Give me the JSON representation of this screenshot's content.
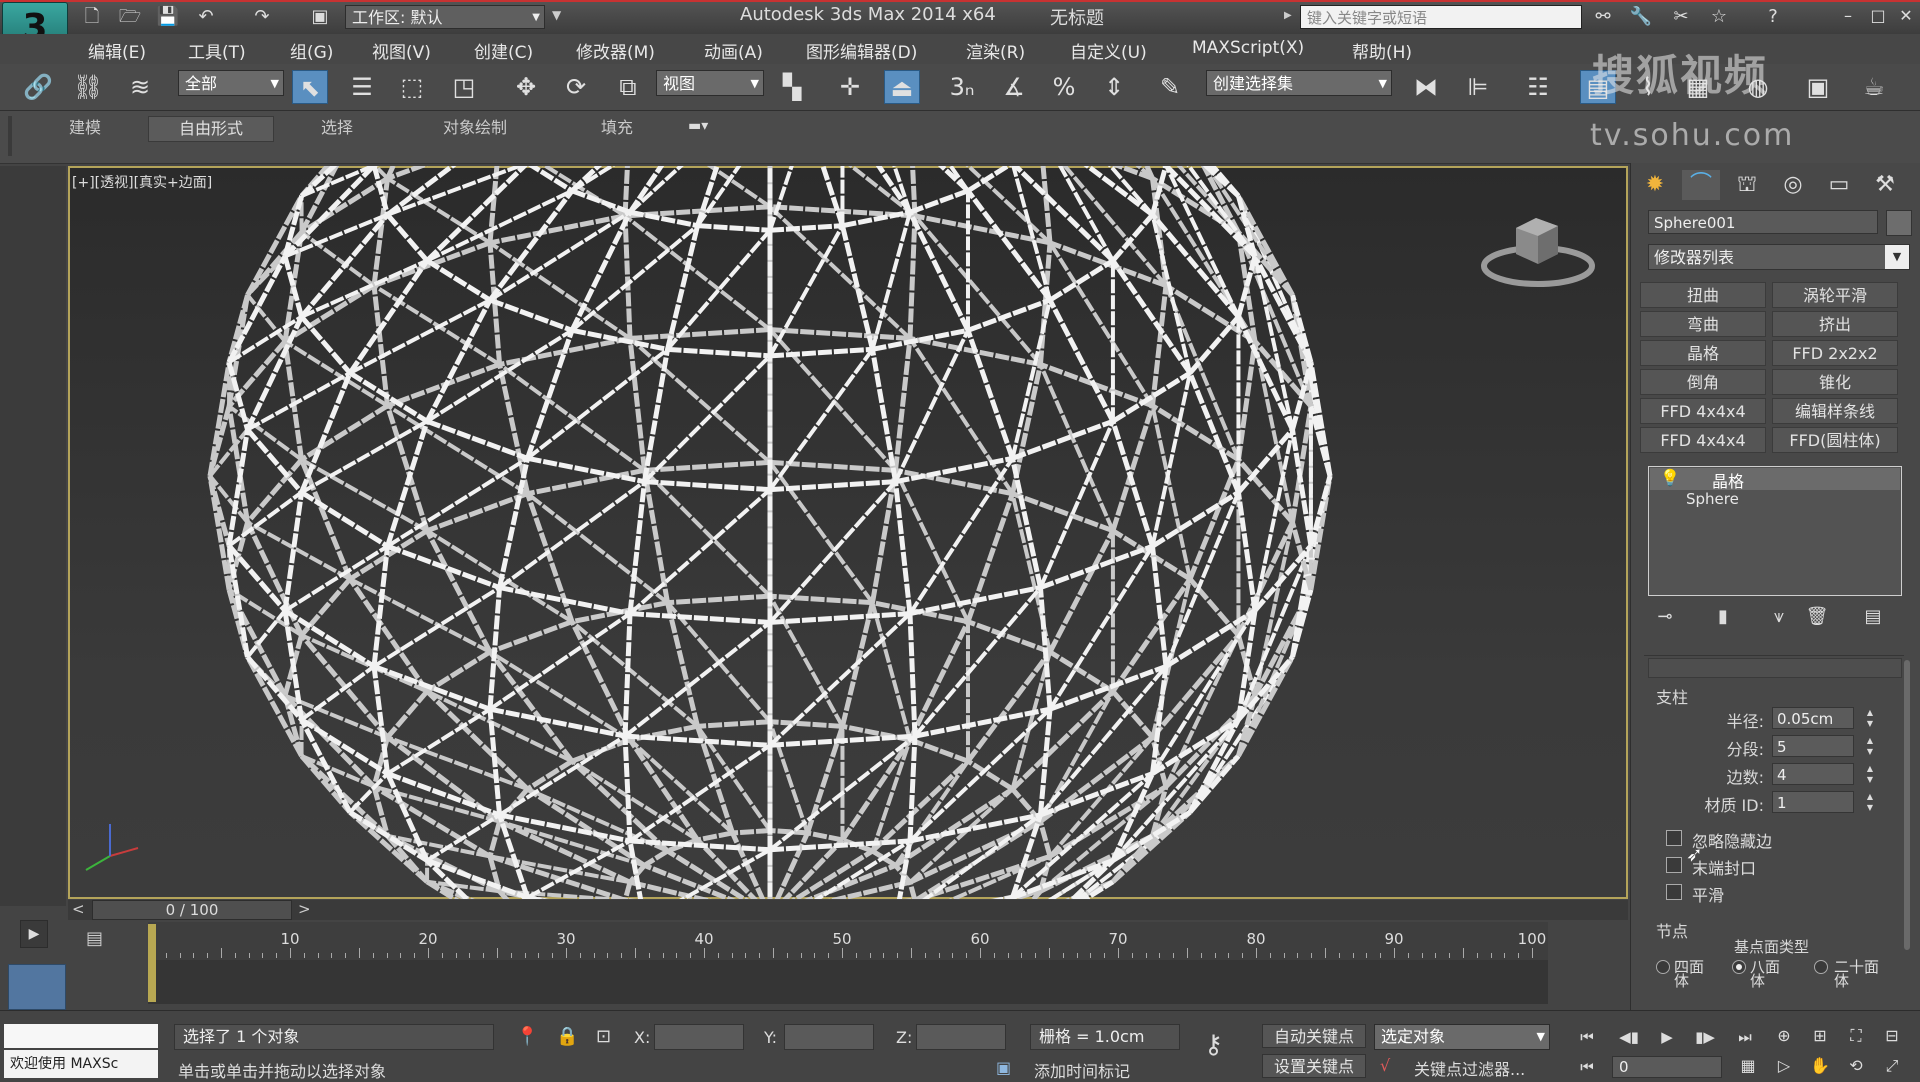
{
  "window": {
    "app_title": "Autodesk 3ds Max  2014 x64",
    "doc_title": "无标题",
    "workspace_label": "工作区: 默认",
    "search_placeholder": "键入关键字或短语"
  },
  "menu": [
    "编辑(E)",
    "工具(T)",
    "组(G)",
    "视图(V)",
    "创建(C)",
    "修改器(M)",
    "动画(A)",
    "图形编辑器(D)",
    "渲染(R)",
    "自定义(U)",
    "MAXScript(X)",
    "帮助(H)"
  ],
  "toolbar": {
    "filter_value": "全部",
    "refcoord_value": "视图",
    "snap_label": "3",
    "named_selection_placeholder": "创建选择集"
  },
  "ribbon": {
    "tabs": [
      "建模",
      "自由形式",
      "选择",
      "对象绘制",
      "填充"
    ]
  },
  "watermark": {
    "line1": "搜狐视频",
    "line2": "tv.sohu.com"
  },
  "viewport": {
    "label": "[+][透视][真实+边面]"
  },
  "command_panel": {
    "object_name": "Sphere001",
    "modifier_list": "修改器列表",
    "modifier_buttons": [
      [
        "扭曲",
        "涡轮平滑"
      ],
      [
        "弯曲",
        "挤出"
      ],
      [
        "晶格",
        "FFD 2x2x2"
      ],
      [
        "倒角",
        "锥化"
      ],
      [
        "FFD 4x4x4",
        "编辑样条线"
      ],
      [
        "FFD 4x4x4",
        "FFD(圆柱体)"
      ]
    ],
    "stack": {
      "modifier": "晶格",
      "base": "Sphere"
    },
    "struts": {
      "title": "支柱",
      "radius_label": "半径:",
      "radius_value": "0.05cm",
      "segments_label": "分段:",
      "segments_value": "5",
      "sides_label": "边数:",
      "sides_value": "4",
      "matid_label": "材质 ID:",
      "matid_value": "1",
      "ignore_hidden": "忽略隐藏边",
      "end_caps": "末端封口",
      "smooth": "平滑"
    },
    "joints": {
      "title": "节点",
      "geodesic_title": "基点面类型",
      "options": [
        "四面体",
        "八面体",
        "二十面体"
      ],
      "selected": 1
    }
  },
  "timeline": {
    "frame_display": "0 / 100",
    "ticks": [
      10,
      20,
      30,
      40,
      50,
      60,
      70,
      80,
      90,
      100
    ]
  },
  "status": {
    "welcome": "欢迎使用 MAXSc",
    "selected": "选择了 1 个对象",
    "prompt": "单击或单击并拖动以选择对象",
    "x_label": "X:",
    "y_label": "Y:",
    "z_label": "Z:",
    "grid": "栅格 = 1.0cm",
    "add_time_tag": "添加时间标记",
    "auto_key": "自动关键点",
    "set_key": "设置关键点",
    "selected_object": "选定对象",
    "key_filters": "关键点过滤器...",
    "frame": "0"
  },
  "colors": {
    "viewport_border": "#b4a45a",
    "active_button": "#5a8fc0"
  }
}
